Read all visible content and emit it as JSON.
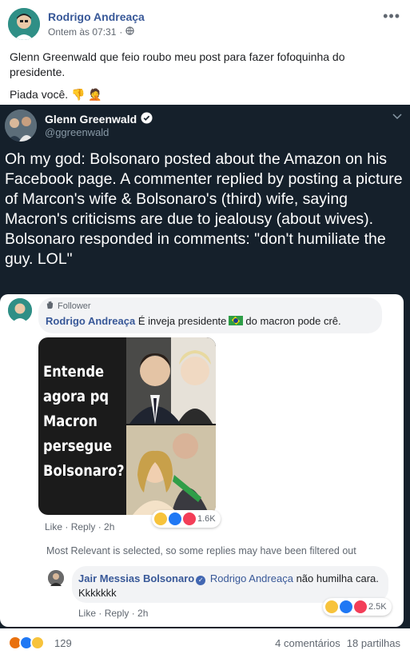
{
  "post": {
    "author": "Rodrigo Andreaça",
    "time": "Ontem às 07:31",
    "separator": "·",
    "body_line1": "Glenn Greenwald que feio roubo meu post para fazer fofoquinha do presidente.",
    "body_line2": "Piada você.",
    "body_line2_emojis": "👎 🤦"
  },
  "tweet": {
    "name": "Glenn Greenwald",
    "handle": "@ggreenwald",
    "text": "Oh my god: Bolsonaro posted about the Amazon on his Facebook page. A commenter replied by posting a picture of Marcon's wife & Bolsonaro's (third) wife, saying Macron's criticisms are due to jealousy (about wives). Bolsonaro responded in comments: \"don't humiliate the guy. LOL\""
  },
  "screenshot": {
    "badge": "Follower",
    "comment1_author": "Rodrigo Andreaça",
    "comment1_text_a": "É inveja presidente",
    "comment1_text_b": "do macron pode crê.",
    "meme_text": "Entende agora pq Macron persegue Bolsonaro?",
    "comment1_reactions": "1.6K",
    "like": "Like",
    "dot": " · ",
    "reply": "Reply",
    "comment1_age": "2h",
    "filter_note": "Most Relevant is selected, so some replies may have been filtered out",
    "comment2_author": "Jair Messias Bolsonaro",
    "comment2_mention": "Rodrigo Andreaça",
    "comment2_text": "não humilha cara. Kkkkkkk",
    "comment2_reactions": "2.5K",
    "comment2_age": "2h"
  },
  "footer": {
    "reaction_count": "129",
    "comments": "4 comentários",
    "shares": "18 partilhas"
  },
  "colors": {
    "fb_link": "#385898",
    "tweet_bg": "#15202b",
    "muted": "#606770"
  }
}
